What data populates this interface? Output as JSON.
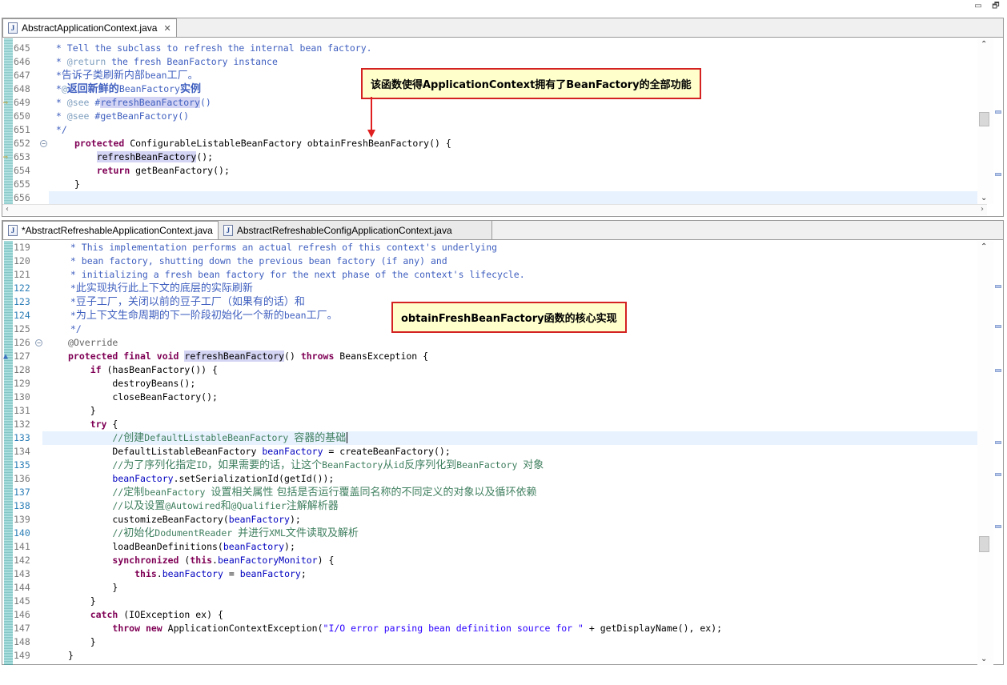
{
  "editor1": {
    "tab": {
      "label": "AbstractApplicationContext.java",
      "close": "✕"
    },
    "lines": [
      {
        "n": "645"
      },
      {
        "n": "646"
      },
      {
        "n": "647"
      },
      {
        "n": "648"
      },
      {
        "n": "649"
      },
      {
        "n": "650"
      },
      {
        "n": "651"
      },
      {
        "n": "652"
      },
      {
        "n": "653"
      },
      {
        "n": "654"
      },
      {
        "n": "655"
      },
      {
        "n": "656"
      }
    ],
    "code": {
      "l645": " * Tell the subclass to refresh the internal bean factory.",
      "l646a": " * ",
      "l646b": "@return",
      "l646c": " the fresh BeanFactory instance",
      "l647a": " *",
      "l647b": "告诉子类刷新内部",
      "l647c": "bean",
      "l647d": "工厂。",
      "l648a": " *",
      "l648b": "@",
      "l648c": "返回新鲜的",
      "l648d": "BeanFactory",
      "l648e": "实例",
      "l649a": " * ",
      "l649b": "@see",
      "l649c": " #",
      "l649d": "refreshBeanFactory",
      "l649e": "()",
      "l650a": " * ",
      "l650b": "@see",
      "l650c": " #getBeanFactory()",
      "l651": " */",
      "l652a": "protected",
      "l652b": " ConfigurableListableBeanFactory obtainFreshBeanFactory() {",
      "l653a": "    ",
      "l653b": "refreshBeanFactory",
      "l653c": "();",
      "l654a": "    ",
      "l654b": "return",
      "l654c": " getBeanFactory();",
      "l655": "}"
    },
    "callout": "该函数使得ApplicationContext拥有了BeanFactory的全部功能"
  },
  "editor2": {
    "tabs": [
      {
        "label": "*AbstractRefreshableApplicationContext.java"
      },
      {
        "label": "AbstractRefreshableConfigApplicationContext.java"
      }
    ],
    "lines": [
      {
        "n": "119"
      },
      {
        "n": "120"
      },
      {
        "n": "121"
      },
      {
        "n": "122"
      },
      {
        "n": "123"
      },
      {
        "n": "124"
      },
      {
        "n": "125"
      },
      {
        "n": "126"
      },
      {
        "n": "127"
      },
      {
        "n": "128"
      },
      {
        "n": "129"
      },
      {
        "n": "130"
      },
      {
        "n": "131"
      },
      {
        "n": "132"
      },
      {
        "n": "133"
      },
      {
        "n": "134"
      },
      {
        "n": "135"
      },
      {
        "n": "136"
      },
      {
        "n": "137"
      },
      {
        "n": "138"
      },
      {
        "n": "139"
      },
      {
        "n": "140"
      },
      {
        "n": "141"
      },
      {
        "n": "142"
      },
      {
        "n": "143"
      },
      {
        "n": "144"
      },
      {
        "n": "145"
      },
      {
        "n": "146"
      },
      {
        "n": "147"
      },
      {
        "n": "148"
      },
      {
        "n": "149"
      }
    ],
    "code": {
      "l119": " * This implementation performs an actual refresh of this context's underlying",
      "l120": " * bean factory, shutting down the previous bean factory (if any) and",
      "l121": " * initializing a fresh bean factory for the next phase of the context's lifecycle.",
      "l122a": " *",
      "l122b": "此实现执行此上下文的底层的实际刷新",
      "l123a": " *",
      "l123b": "豆子工厂，关闭以前的豆子工厂（如果有的话）和",
      "l124a": " *",
      "l124b": "为上下文生命周期的下一阶段初始化一个新的",
      "l124c": "bean",
      "l124d": "工厂。",
      "l125": " */",
      "l126": "@Override",
      "l127a": "protected final void",
      "l127b": " ",
      "l127c": "refreshBeanFactory",
      "l127d": "() ",
      "l127e": "throws",
      "l127f": " BeansException {",
      "l128a": "    ",
      "l128b": "if",
      "l128c": " (hasBeanFactory()) {",
      "l129": "        destroyBeans();",
      "l130": "        closeBeanFactory();",
      "l131": "    }",
      "l132a": "    ",
      "l132b": "try",
      "l132c": " {",
      "l133a": "        //",
      "l133b": "创建",
      "l133c": "DefaultListableBeanFactory ",
      "l133d": "容器的基础",
      "l134a": "        DefaultListableBeanFactory ",
      "l134b": "beanFactory",
      "l134c": " = createBeanFactory();",
      "l135a": "        //",
      "l135b": "为了序列化指定",
      "l135c": "ID",
      "l135d": "，如果需要的话，让这个",
      "l135e": "BeanFactory",
      "l135f": "从",
      "l135g": "id",
      "l135h": "反序列化到",
      "l135i": "BeanFactory ",
      "l135j": "对象",
      "l136a": "        ",
      "l136b": "beanFactory",
      "l136c": ".setSerializationId(getId());",
      "l137a": "        //",
      "l137b": "定制",
      "l137c": "beanFactory ",
      "l137d": "设置相关属性 包括是否运行覆盖同名称的不同定义的对象以及循环依赖",
      "l138a": "        //",
      "l138b": "以及设置",
      "l138c": "@Autowired",
      "l138d": "和",
      "l138e": "@Qualifier",
      "l138f": "注解解析器",
      "l139a": "        customizeBeanFactory(",
      "l139b": "beanFactory",
      "l139c": ");",
      "l140a": "        //",
      "l140b": "初始化",
      "l140c": "DodumentReader ",
      "l140d": "并进行",
      "l140e": "XML",
      "l140f": "文件读取及解析",
      "l141a": "        loadBeanDefinitions(",
      "l141b": "beanFactory",
      "l141c": ");",
      "l142a": "        ",
      "l142b": "synchronized",
      "l142c": " (",
      "l142d": "this",
      "l142e": ".",
      "l142f": "beanFactoryMonitor",
      "l142g": ") {",
      "l143a": "            ",
      "l143b": "this",
      "l143c": ".",
      "l143d": "beanFactory",
      "l143e": " = ",
      "l143f": "beanFactory",
      "l143g": ";",
      "l144": "        }",
      "l145": "    }",
      "l146a": "    ",
      "l146b": "catch",
      "l146c": " (IOException ex) {",
      "l147a": "        ",
      "l147b": "throw",
      "l147c": " ",
      "l147d": "new",
      "l147e": " ApplicationContextException(",
      "l147f": "\"I/O error parsing bean definition source for \"",
      "l147g": " + getDisplayName(), ex);",
      "l148": "    }",
      "l149": "}"
    },
    "callout": "obtainFreshBeanFactory函数的核心实现"
  },
  "window": {
    "minimize": "▭",
    "restore": "🗗"
  },
  "colors": {
    "callout_border": "#d42222",
    "callout_bg": "#ffffcc",
    "keyword": "#7f0055",
    "comment": "#3f7f5f",
    "javadoc": "#3f5fbf"
  }
}
